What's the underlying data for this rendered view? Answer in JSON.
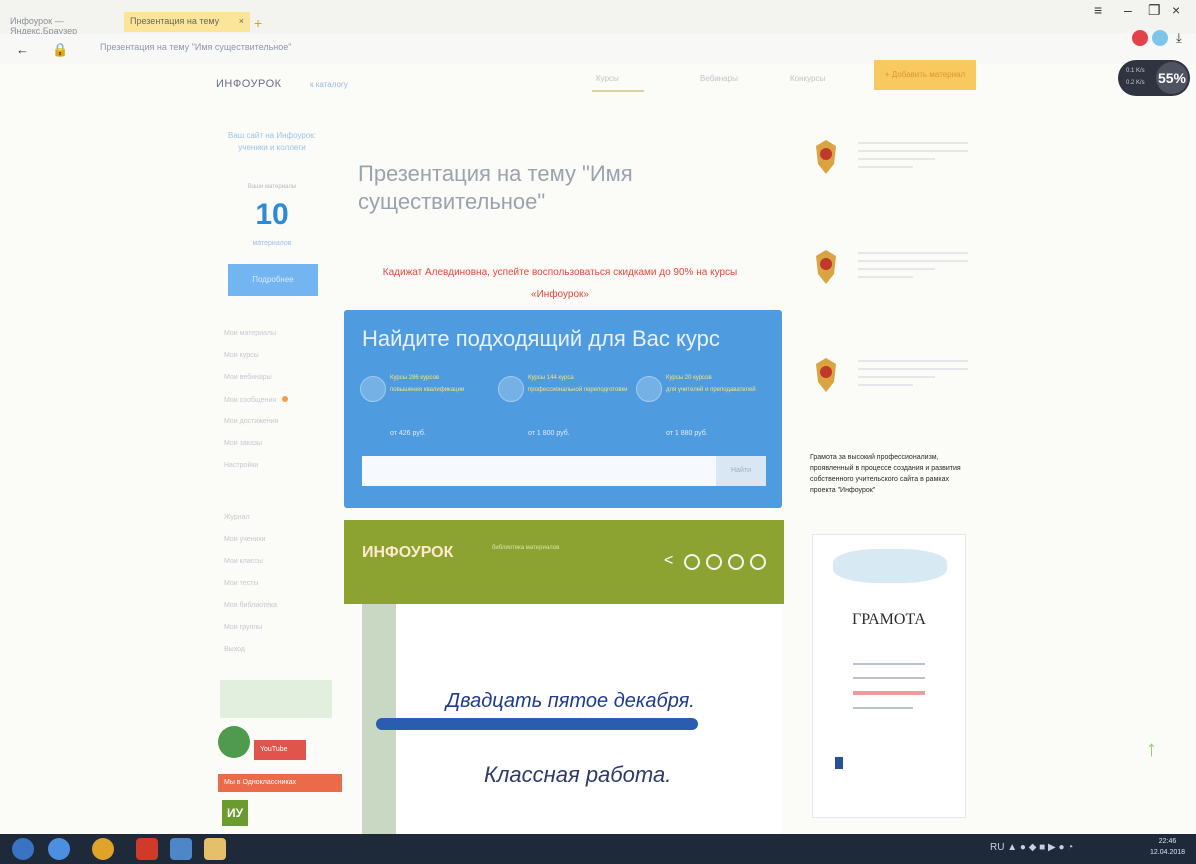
{
  "browser": {
    "tabs": [
      {
        "label": "Инфоурок — Яндекс.Браузер"
      },
      {
        "label": "Презентация на тему"
      }
    ],
    "address": "Презентация на тему \"Имя существительное\"",
    "speed": {
      "value": "55%",
      "up": "0.1 K/s",
      "down": "0.2 K/s"
    }
  },
  "site": {
    "logo": "ИНФОУРОК",
    "logo_sub": "к каталогу",
    "nav": [
      "Курсы",
      "Вебинары",
      "Конкурсы"
    ],
    "add_material": "+ Добавить материал"
  },
  "sidebar": {
    "links": "Ваш сайт на Инфоурок: ученики и коллеги",
    "caption": "Ваши материалы",
    "number": "10",
    "unit": "материалов",
    "button": "Подробнее",
    "list": [
      "Мои материалы",
      "Мои курсы",
      "Мои вебинары",
      "Мои сообщения",
      "Мои достижения",
      "Мои заказы",
      "Настройки"
    ],
    "list2": [
      "Журнал",
      "Мои ученики",
      "Мои классы",
      "Мои тесты",
      "Моя библиотека",
      "Мои группы",
      "Выход"
    ],
    "youtube": "YouTube",
    "red_banner": "Мы в Одноклассниках",
    "iu_logo": "ИУ"
  },
  "article": {
    "title": "Презентация на тему \"Имя существительное\"",
    "promo": "Кадижат Алевдиновна, успейте воспользоваться скидками до 90% на курсы «Инфоурок»"
  },
  "course_box": {
    "heading": "Найдите подходящий для Вас курс",
    "columns": [
      {
        "label": "Курсы 286 курсов",
        "desc": "повышения квалификации",
        "price": "от 426 руб."
      },
      {
        "label": "Курсы 144 курса",
        "desc": "профессиональной переподготовки",
        "price": "от 1 800 руб."
      },
      {
        "label": "Курсы 20 курсов",
        "desc": "для учителей и преподавателей",
        "price": "от 1 880 руб."
      }
    ],
    "search_placeholder": "",
    "search_button": "Найти"
  },
  "green_banner": {
    "logo": "ИНФОУРОК",
    "sub": "библиотека материалов"
  },
  "slide": {
    "date": "Двадцать пятое декабря.",
    "class": "Классная работа."
  },
  "right": {
    "gramota_caption": "Грамота за высокий профессионализм, проявленный в процессе создания и развития собственного учительского сайта в рамках проекта \"Инфоурок\"",
    "gramota_title": "ГРАМОТА"
  },
  "taskbar": {
    "time": "22:46",
    "date": "12.04.2018"
  },
  "colors": {
    "brand_blue": "#4f9be0",
    "promo_red": "#e2483c",
    "brand_green": "#8da331",
    "accent_yellow": "#f9c85e"
  }
}
